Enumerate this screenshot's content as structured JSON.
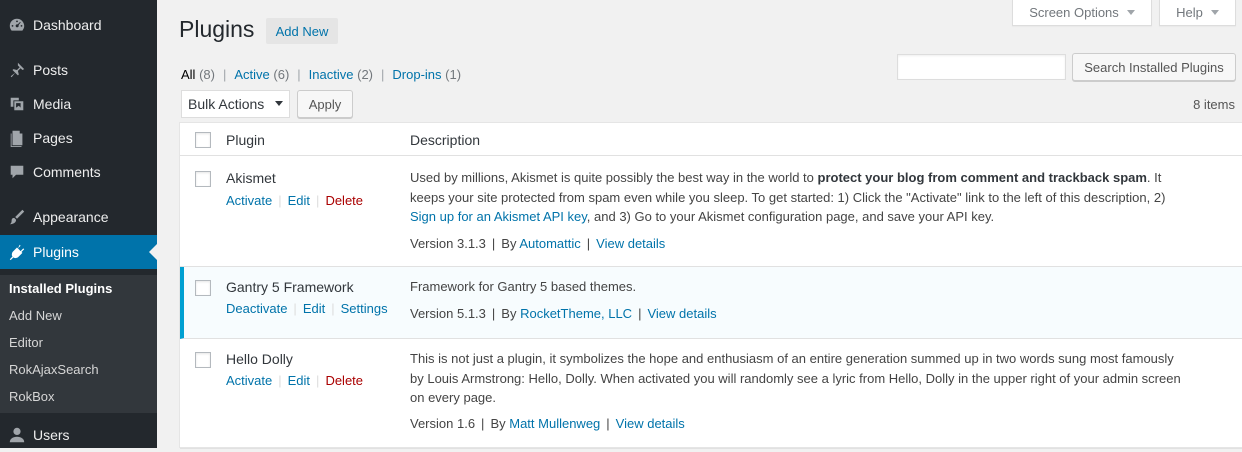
{
  "menu": {
    "items": [
      {
        "label": "Dashboard",
        "icon": "dashboard-icon"
      },
      {
        "label": "Posts",
        "icon": "pushpin-icon"
      },
      {
        "label": "Media",
        "icon": "media-icon"
      },
      {
        "label": "Pages",
        "icon": "pages-icon"
      },
      {
        "label": "Comments",
        "icon": "comment-icon"
      },
      {
        "label": "Appearance",
        "icon": "paintbrush-icon"
      },
      {
        "label": "Plugins",
        "icon": "plugin-icon"
      },
      {
        "label": "Users",
        "icon": "users-icon"
      }
    ],
    "submenu": [
      "Installed Plugins",
      "Add New",
      "Editor",
      "RokAjaxSearch",
      "RokBox"
    ],
    "accent_color": "#0073aa",
    "background_color": "#23282d"
  },
  "screen_options": "Screen Options",
  "help": "Help",
  "header": {
    "title": "Plugins",
    "add_new": "Add New"
  },
  "filters": {
    "all": {
      "label": "All",
      "count": "(8)"
    },
    "active": {
      "label": "Active",
      "count": "(6)"
    },
    "inactive": {
      "label": "Inactive",
      "count": "(2)"
    },
    "dropins": {
      "label": "Drop-ins",
      "count": "(1)"
    }
  },
  "search": {
    "button": "Search Installed Plugins",
    "value": ""
  },
  "bulk": {
    "selected": "Bulk Actions",
    "apply": "Apply"
  },
  "items_count": "8 items",
  "table": {
    "col_plugin": "Plugin",
    "col_description": "Description",
    "rows": [
      {
        "name": "Akismet",
        "actions": [
          "Activate",
          "Edit",
          "Delete"
        ],
        "desc_line1_pre": "Used by millions, Akismet is quite possibly the best way in the world to ",
        "desc_line1_bold": "protect your blog from comment and trackback spam",
        "desc_line1_post": ". It",
        "desc_line2": "keeps your site protected from spam even while you sleep. To get started: 1) Click the \"Activate\" link to the left of this description, 2)",
        "desc_line3_link": "Sign up for an Akismet API key",
        "desc_line3_post": ", and 3) Go to your Akismet configuration page, and save your API key.",
        "version": "Version 3.1.3",
        "by": "By",
        "author": "Automattic",
        "details": "View details"
      },
      {
        "name": "Gantry 5 Framework",
        "actions": [
          "Deactivate",
          "Edit",
          "Settings"
        ],
        "desc": "Framework for Gantry 5 based themes.",
        "version": "Version 5.1.3",
        "by": "By",
        "author": "RocketTheme, LLC",
        "details": "View details"
      },
      {
        "name": "Hello Dolly",
        "actions": [
          "Activate",
          "Edit",
          "Delete"
        ],
        "desc_line1": "This is not just a plugin, it symbolizes the hope and enthusiasm of an entire generation summed up in two words sung most famously",
        "desc_line2": "by Louis Armstrong: Hello, Dolly. When activated you will randomly see a lyric from Hello, Dolly in the upper right of your admin screen",
        "desc_line3": "on every page.",
        "version": "Version 1.6",
        "by": "By",
        "author": "Matt Mullenweg",
        "details": "View details"
      }
    ]
  }
}
